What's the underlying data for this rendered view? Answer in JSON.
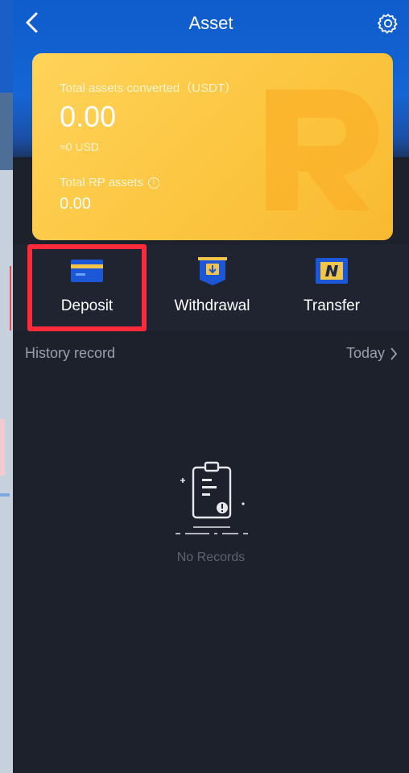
{
  "header": {
    "title": "Asset"
  },
  "card": {
    "total_label": "Total assets converted（USDT）",
    "total_value": "0.00",
    "usd_value": "≈0 USD",
    "rp_label": "Total RP assets",
    "rp_value": "0.00",
    "info_symbol": "i"
  },
  "actions": [
    {
      "label": "Deposit",
      "icon": "deposit-card-icon"
    },
    {
      "label": "Withdrawal",
      "icon": "withdrawal-icon"
    },
    {
      "label": "Transfer",
      "icon": "transfer-icon"
    }
  ],
  "history": {
    "title": "History record",
    "filter": "Today"
  },
  "empty": {
    "text": "No Records"
  },
  "colors": {
    "header_blue": "#1565d4",
    "card_gold": "#fcc640",
    "background": "#1c212c",
    "highlight": "#ff2b3b"
  }
}
